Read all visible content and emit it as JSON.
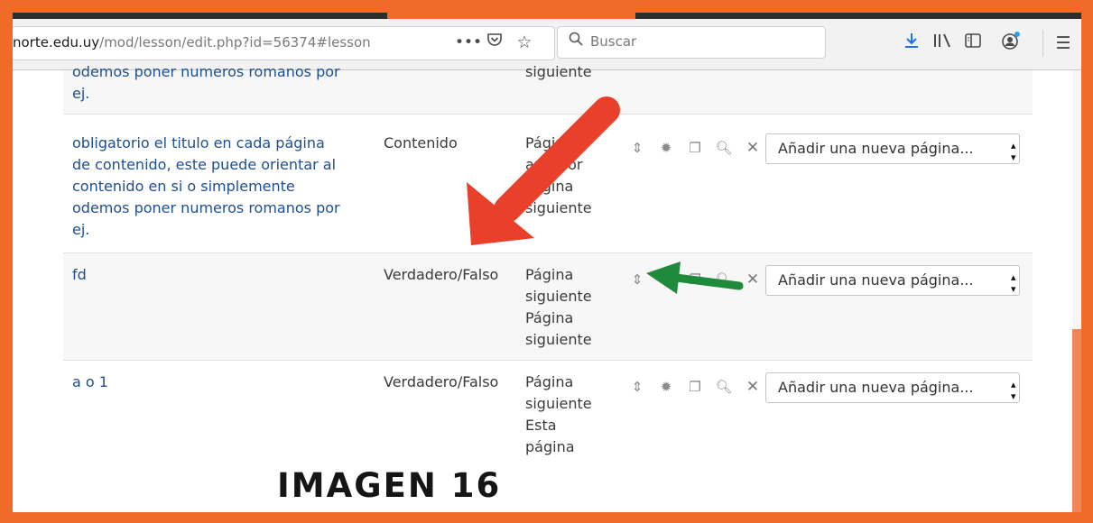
{
  "browser": {
    "url_host": "norte.edu.uy",
    "url_path": "/mod/lesson/edit.php?id=56374#lesson",
    "search_placeholder": "Buscar",
    "icons": [
      "more-icon",
      "pocket-icon",
      "bookmark-star-icon",
      "download-icon",
      "library-icon",
      "sidebar-icon",
      "account-icon",
      "menu-icon"
    ]
  },
  "rows": [
    {
      "title_lines": [
        "odemos poner numeros romanos por",
        "ej."
      ],
      "jump_lines": [
        "siguiente"
      ]
    },
    {
      "title_lines": [
        "obligatorio el titulo en cada página",
        "de contenido, este puede orientar al",
        "contenido en si o simplemente",
        "odemos poner numeros romanos por",
        "ej."
      ],
      "type": "Contenido",
      "jump_lines": [
        "Página",
        "anterior",
        "Página",
        "siguiente"
      ],
      "select_value": "Añadir una nueva página..."
    },
    {
      "title_lines": [
        "fd"
      ],
      "type": "Verdadero/Falso",
      "jump_lines": [
        "Página",
        "siguiente",
        "Página",
        "siguiente"
      ],
      "select_value": "Añadir una nueva página..."
    },
    {
      "title_lines": [
        "a o 1"
      ],
      "type": "Verdadero/Falso",
      "jump_lines": [
        "Página",
        "siguiente",
        "Esta",
        "página"
      ],
      "select_value": "Añadir una nueva página..."
    }
  ],
  "action_icons": [
    "move-icon",
    "settings-gear-icon",
    "duplicate-icon",
    "preview-magnifier-icon",
    "delete-x-icon"
  ],
  "caption": "IMAGEN 16",
  "colors": {
    "frame": "#f06a28",
    "arrow_red": "#e8402a",
    "arrow_green": "#1f8a3c",
    "link": "#1d4f91"
  }
}
